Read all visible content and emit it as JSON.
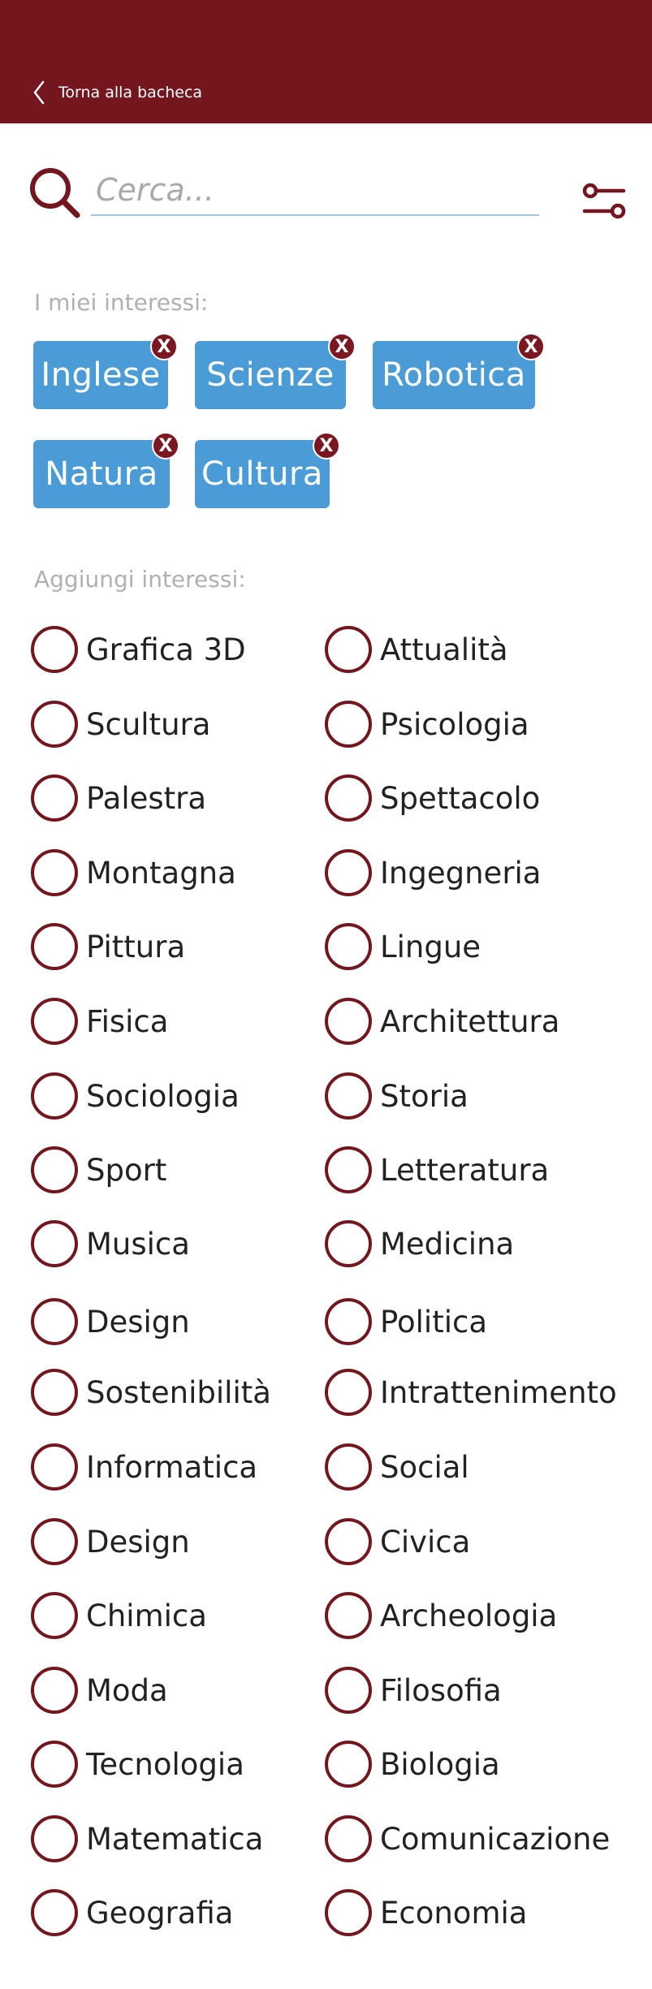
{
  "header": {
    "back_label": "Torna alla bacheca",
    "background": "#73161e"
  },
  "search": {
    "placeholder": "Cerca...",
    "value": ""
  },
  "my_interests": {
    "title": "I miei interessi:",
    "remove_label": "X",
    "chips": [
      "Inglese",
      "Scienze",
      "Robotica",
      "Natura",
      "Cultura"
    ],
    "chip_color": "#4a9bd6"
  },
  "add_interests": {
    "title": "Aggiungi interessi:",
    "left": [
      "Grafica 3D",
      "Scultura",
      "Palestra",
      "Montagna",
      "Pittura",
      "Fisica",
      "Sociologia",
      "Sport",
      "Musica",
      "Design",
      "Sostenibilità",
      "Informatica",
      "Design",
      "Chimica",
      "Moda",
      "Tecnologia",
      "Matematica",
      "Geografia"
    ],
    "right": [
      "Attualità",
      "Psicologia",
      "Spettacolo",
      "Ingegneria",
      "Lingue",
      "Architettura",
      "Storia",
      "Letteratura",
      "Medicina",
      "Politica",
      "Intrattenimento",
      "Social",
      "Civica",
      "Archeologia",
      "Filosofia",
      "Biologia",
      "Comunicazione",
      "Economia"
    ]
  },
  "icons": {
    "back": "chevron-left-icon",
    "search": "search-icon",
    "filter": "filter-icon",
    "remove": "close-icon"
  },
  "accent_color": "#73161e"
}
